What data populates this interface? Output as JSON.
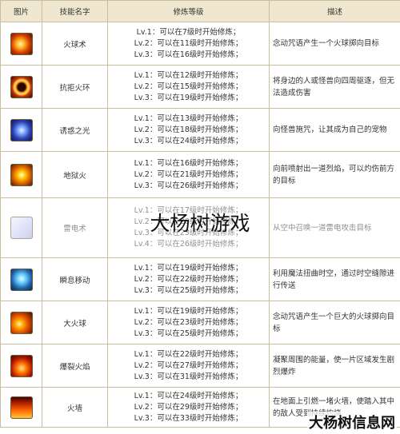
{
  "headers": [
    "图片",
    "技能名字",
    "修炼等级",
    "描述"
  ],
  "skills": [
    {
      "icon": "fireball-icon",
      "icon_class": "i-fire",
      "name": "火球术",
      "levels": [
        "Lv.1：可以在7级时开始修炼；",
        "Lv.2：可以在11级时开始修炼；",
        "Lv.3：可以在16级时开始修炼；"
      ],
      "desc": "念动咒语产生一个火球掷向目标"
    },
    {
      "icon": "fire-ring-icon",
      "icon_class": "i-ring",
      "name": "抗拒火环",
      "levels": [
        "Lv.1：可以在12级时开始修炼；",
        "Lv.2：可以在15级时开始修炼；",
        "Lv.3：可以在19级时开始修炼；"
      ],
      "desc": "将身边的人或怪兽向四周驱逐，但无法造成伤害"
    },
    {
      "icon": "charm-light-icon",
      "icon_class": "i-charm",
      "name": "诱惑之光",
      "levels": [
        "Lv.1：可以在13级时开始修炼；",
        "Lv.2：可以在18级时开始修炼；",
        "Lv.3：可以在24级时开始修炼；"
      ],
      "desc": "向怪兽施咒，让其成为自己的宠物"
    },
    {
      "icon": "hellfire-icon",
      "icon_class": "i-hell",
      "name": "地狱火",
      "levels": [
        "Lv.1：可以在16级时开始修炼；",
        "Lv.2：可以在21级时开始修炼；",
        "Lv.3：可以在26级时开始修炼；"
      ],
      "desc": "向前喷射出一道烈焰，可以灼伤前方的目标"
    },
    {
      "icon": "thunder-icon",
      "icon_class": "i-thunder",
      "name": "雷电术",
      "levels": [
        "Lv.1：可以在17级时开始修炼；",
        "Lv.2：可以在20级时开始修炼；",
        "Lv.3：可以在23级时开始修炼；",
        "Lv.4：可以在26级时开始修炼；"
      ],
      "desc": "从空中召唤一道雷电攻击目标"
    },
    {
      "icon": "teleport-icon",
      "icon_class": "i-blink",
      "name": "瞬息移动",
      "levels": [
        "Lv.1：可以在19级时开始修炼；",
        "Lv.2：可以在22级时开始修炼；",
        "Lv.3：可以在25级时开始修炼；"
      ],
      "desc": "利用魔法扭曲时空，通过时空缝隙进行传送"
    },
    {
      "icon": "big-fireball-icon",
      "icon_class": "i-bigfire",
      "name": "大火球",
      "levels": [
        "Lv.1：可以在19级时开始修炼；",
        "Lv.2：可以在23级时开始修炼；",
        "Lv.3：可以在25级时开始修炼；"
      ],
      "desc": "念动咒语产生一个巨大的火球掷向目标"
    },
    {
      "icon": "blast-icon",
      "icon_class": "i-burst",
      "name": "爆裂火焰",
      "levels": [
        "Lv.1：可以在22级时开始修炼；",
        "Lv.2：可以在27级时开始修炼；",
        "Lv.3：可以在31级时开始修炼；"
      ],
      "desc": "凝聚周围的能量，使一片区域发生剧烈爆炸"
    },
    {
      "icon": "fire-wall-icon",
      "icon_class": "i-wall",
      "name": "火墙",
      "levels": [
        "Lv.1：可以在24级时开始修炼；",
        "Lv.2：可以在29级时开始修炼；",
        "Lv.3：可以在33级时开始修炼；"
      ],
      "desc": "在地面上引燃一堵火墙，使踏入其中的敌人受到持续灼烧"
    }
  ],
  "watermark_center": "大杨树游戏",
  "watermark_corner": "大杨树信息网"
}
